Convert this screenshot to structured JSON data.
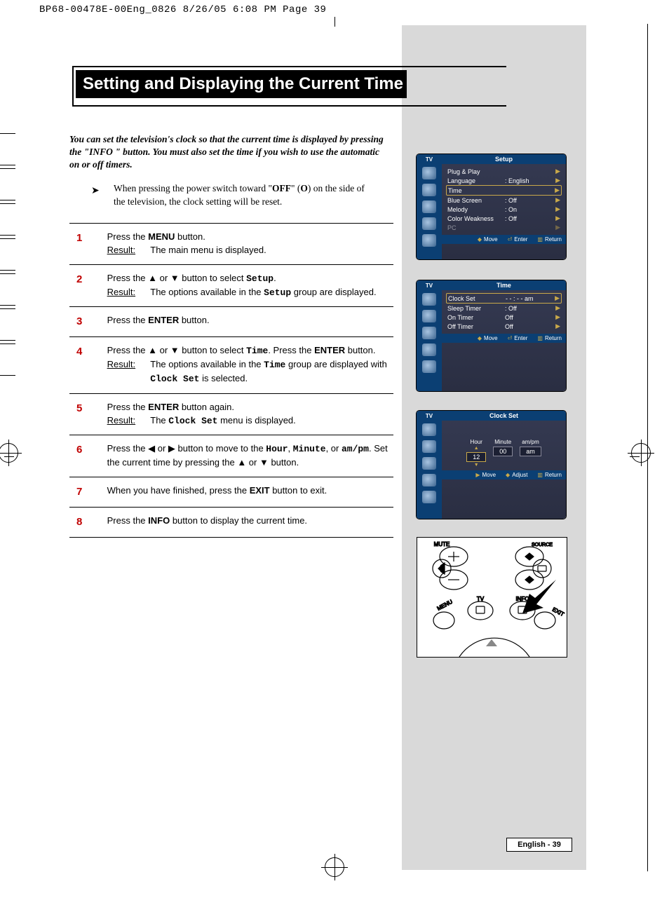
{
  "slug": "BP68-00478E-00Eng_0826  8/26/05  6:08 PM  Page 39",
  "title": "Setting and Displaying the Current Time",
  "intro": "You can set the television's clock so that the current time is displayed by pressing the \"INFO \" button. You must also set the time if you wish to use the automatic on or off timers.",
  "note_pre": "When pressing the power switch toward \"",
  "note_off": "OFF",
  "note_mid": "\" (",
  "note_o": "O",
  "note_post": ") on the side of the television, the clock setting will be reset.",
  "steps": [
    {
      "n": "1",
      "body_pre": "Press the ",
      "body_b": "MENU",
      "body_post": " button.",
      "result": "The main menu is displayed."
    },
    {
      "n": "2",
      "body_pre": "Press the ",
      "body_sym": "▲ or ▼",
      "body_mid": " button to select ",
      "body_mono": "Setup",
      "body_post": ".",
      "result_pre": "The options available in the ",
      "result_mono": "Setup",
      "result_post": " group are displayed."
    },
    {
      "n": "3",
      "body_pre": "Press the ",
      "body_b": "ENTER",
      "body_post": " button."
    },
    {
      "n": "4",
      "body_pre": "Press the ",
      "body_sym": "▲ or ▼",
      "body_mid": " button to select ",
      "body_mono": "Time",
      "body_mid2": ". Press the ",
      "body_b": "ENTER",
      "body_post": " button.",
      "result_pre": "The options available in the ",
      "result_mono": "Time",
      "result_mid": " group are displayed with ",
      "result_mono2": "Clock Set",
      "result_post": " is selected."
    },
    {
      "n": "5",
      "body_pre": "Press the ",
      "body_b": "ENTER",
      "body_post": " button again.",
      "result_pre": "The ",
      "result_mono": "Clock Set",
      "result_post": " menu is displayed."
    },
    {
      "n": "6",
      "body_pre": "Press the ",
      "body_sym": "◀ or ▶",
      "body_mid": " button to move to the ",
      "body_mono": "Hour",
      "body_mid2": ", ",
      "body_mono2": "Minute",
      "body_mid3": ", or ",
      "body_mono3": "am/pm",
      "body_post": ". Set the current time by pressing the ▲ or ▼ button."
    },
    {
      "n": "7",
      "body_pre": "When you have finished, press the ",
      "body_b": "EXIT",
      "body_post": " button to exit."
    },
    {
      "n": "8",
      "body_pre": "Press the ",
      "body_b": "INFO",
      "body_post": " button to display the current time."
    }
  ],
  "result_label": "Result:",
  "osd": {
    "tv": "TV",
    "foot_move": "Move",
    "foot_enter": "Enter",
    "foot_return": "Return",
    "foot_adjust": "Adjust",
    "setup": {
      "title": "Setup",
      "rows": [
        {
          "lab": "Plug & Play",
          "val": ""
        },
        {
          "lab": "Language",
          "val": ": English"
        },
        {
          "lab": "Time",
          "val": "",
          "sel": true
        },
        {
          "lab": "Blue Screen",
          "val": ": Off"
        },
        {
          "lab": "Melody",
          "val": ": On"
        },
        {
          "lab": "Color Weakness",
          "val": ": Off"
        },
        {
          "lab": "PC",
          "val": "",
          "dim": true
        }
      ]
    },
    "time": {
      "title": "Time",
      "rows": [
        {
          "lab": "Clock Set",
          "val": "- - : - -   am",
          "sel": true
        },
        {
          "lab": "Sleep Timer",
          "val": ": Off"
        },
        {
          "lab": "On Timer",
          "val": "Off"
        },
        {
          "lab": "Off Timer",
          "val": "Off"
        }
      ]
    },
    "clock": {
      "title": "Clock Set",
      "cols": [
        {
          "h": "Hour",
          "v": "12",
          "sel": true
        },
        {
          "h": "Minute",
          "v": "00"
        },
        {
          "h": "am/pm",
          "v": "am"
        }
      ]
    }
  },
  "remote": {
    "mute": "MUTE",
    "source": "SOURCE",
    "tv": "TV",
    "info": "INFO",
    "menu": "MENU",
    "exit": "EXIT"
  },
  "pagenum": "English - 39"
}
